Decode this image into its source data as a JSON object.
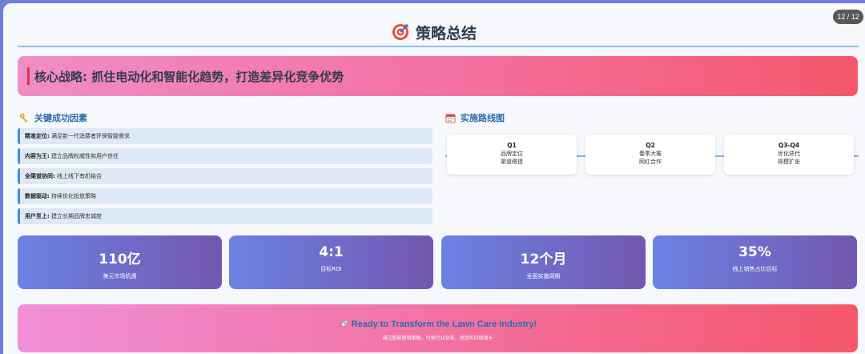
{
  "page_indicator": "12 / 12",
  "title": "策略总结",
  "title_icon": "target-icon",
  "core": {
    "text": "核心战略: 抓住电动化和智能化趋势，打造差异化竞争优势"
  },
  "factors": {
    "heading": "关键成功因素",
    "icon": "key-icon",
    "items": [
      {
        "label": "精准定位:",
        "text": "满足新一代消费者环保智能需求"
      },
      {
        "label": "内容为王:",
        "text": "建立品牌权威性和用户信任"
      },
      {
        "label": "全渠道协同:",
        "text": "线上线下有机结合"
      },
      {
        "label": "数据驱动:",
        "text": "持续优化投放策略"
      },
      {
        "label": "用户至上:",
        "text": "建立长期品牌忠诚度"
      }
    ]
  },
  "roadmap": {
    "heading": "实施路线图",
    "icon": "calendar-icon",
    "phases": [
      {
        "quarter": "Q1",
        "line1": "品牌定位",
        "line2": "渠道搭建"
      },
      {
        "quarter": "Q2",
        "line1": "春季大推",
        "line2": "网红合作"
      },
      {
        "quarter": "Q3-Q4",
        "line1": "优化迭代",
        "line2": "规模扩张"
      }
    ]
  },
  "stats": [
    {
      "value": "110亿",
      "label": "美元市场机遇"
    },
    {
      "value": "4:1",
      "label": "目标ROI"
    },
    {
      "value": "12个月",
      "label": "全面实施周期"
    },
    {
      "value": "35%",
      "label": "线上销售占比目标"
    }
  ],
  "cta": {
    "icon": "rocket-icon",
    "title": "Ready to Transform the Lawn Care Industry!",
    "subtitle": "通过智能营销策略，引领行业变革，创造可持续增长"
  },
  "colors": {
    "accent_blue": "#2b6cb0",
    "banner_pink": "#f5576c",
    "stat_purple": "#7357b0"
  }
}
